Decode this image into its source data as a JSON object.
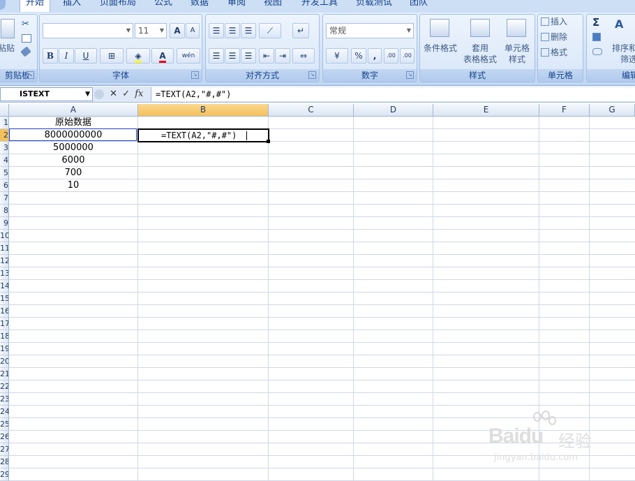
{
  "ribbon_tabs": [
    "开始",
    "插入",
    "页面布局",
    "公式",
    "数据",
    "审阅",
    "视图",
    "开发工具",
    "负载测试",
    "团队"
  ],
  "groups": {
    "clipboard": {
      "label": "剪贴板",
      "paste_label": "粘贴"
    },
    "font": {
      "label": "字体",
      "font_size": "11",
      "bold": "B",
      "italic": "I",
      "underline": "U",
      "grow_font": "A",
      "shrink_font": "A",
      "font_color": "A",
      "phonetic": "wén"
    },
    "alignment": {
      "label": "对齐方式"
    },
    "number": {
      "label": "数字",
      "format": "常规",
      "percent": "%",
      "comma": ",",
      "inc_decimal": ".00",
      "dec_decimal": ".00"
    },
    "styles": {
      "label": "样式",
      "conditional": "条件格式",
      "table_format_1": "套用",
      "table_format_2": "表格格式",
      "cell_styles_1": "单元格",
      "cell_styles_2": "样式"
    },
    "cells": {
      "label": "单元格",
      "insert": "插入",
      "delete": "删除",
      "format": "格式"
    },
    "editing": {
      "label": "编辑",
      "sum": "Σ",
      "sort_1": "排序和",
      "sort_2": "筛选"
    }
  },
  "formula_bar": {
    "name_box": "ISTEXT",
    "fx": "fx",
    "formula": "=TEXT(A2,\"#,#\")"
  },
  "columns": [
    "A",
    "B",
    "C",
    "D",
    "E",
    "F",
    "G"
  ],
  "rows": [
    "1",
    "2",
    "3",
    "4",
    "5",
    "6",
    "7",
    "8",
    "9",
    "10",
    "11",
    "12",
    "13",
    "14",
    "15",
    "16",
    "17",
    "18",
    "19",
    "20",
    "21",
    "22",
    "23",
    "24",
    "25",
    "26",
    "27",
    "28",
    "29"
  ],
  "cells": {
    "A1": "原始数据",
    "A2": "8000000000",
    "A3": "5000000",
    "A4": "6000",
    "A5": "700",
    "A6": "10",
    "B2": "=TEXT(A2,\"#,#\")"
  },
  "watermark": {
    "brand": "Baidu",
    "product": "经验",
    "url": "jingyan.baidu.com"
  }
}
